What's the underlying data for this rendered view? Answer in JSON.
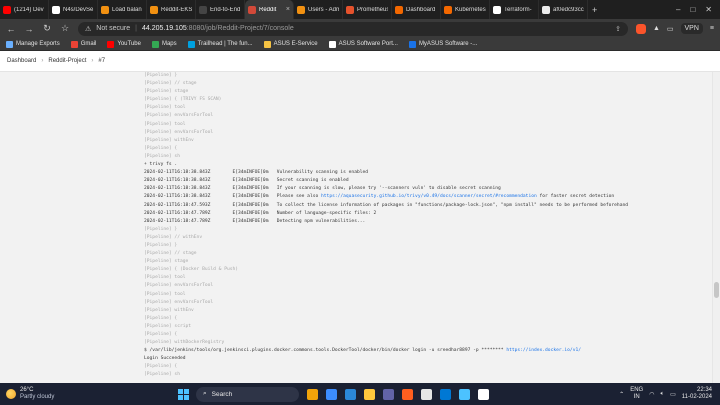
{
  "browser": {
    "tabs": [
      {
        "label": "(1214) Dev",
        "color": "#ff0000",
        "active": false
      },
      {
        "label": "N4s/DevSe",
        "color": "#ffffff",
        "active": false
      },
      {
        "label": "Load balan",
        "color": "#f29111",
        "active": false
      },
      {
        "label": "Reddit-EKS",
        "color": "#f29111",
        "active": false
      },
      {
        "label": "End-to-End",
        "color": "#444444",
        "active": false
      },
      {
        "label": "Reddit",
        "color": "#d24939",
        "active": true
      },
      {
        "label": "Users - Adm",
        "color": "#f29111",
        "active": false
      },
      {
        "label": "Prometheus",
        "color": "#e6522c",
        "active": false
      },
      {
        "label": "Dashboard",
        "color": "#f46800",
        "active": false
      },
      {
        "label": "Kubernetes",
        "color": "#f46800",
        "active": false
      },
      {
        "label": "Terraform-",
        "color": "#ffffff",
        "active": false
      },
      {
        "label": "af0edc93cc",
        "color": "#eaeaea",
        "active": false
      }
    ],
    "address": {
      "security": "Not secure",
      "host": "44.205.19.105",
      "path": ":8080/job/Reddit-Project/7/console"
    },
    "vpn_label": "VPN",
    "bookmarks": [
      {
        "label": "Manage Exports",
        "color": "#6ab0ff"
      },
      {
        "label": "Gmail",
        "color": "#ea4335"
      },
      {
        "label": "YouTube",
        "color": "#ff0000"
      },
      {
        "label": "Maps",
        "color": "#34a853"
      },
      {
        "label": "Trailhead | The fun...",
        "color": "#00a1e0"
      },
      {
        "label": "ASUS E-Service",
        "color": "#f6c343"
      },
      {
        "label": "ASUS Software Port...",
        "color": "#ffffff"
      },
      {
        "label": "MyASUS Software -...",
        "color": "#1a73e8"
      }
    ]
  },
  "jenkins": {
    "breadcrumb": [
      "Dashboard",
      "Reddit-Project",
      "#7"
    ]
  },
  "console_lines": [
    {
      "t": "[Pipeline] }",
      "k": "pl"
    },
    {
      "t": "[Pipeline] // stage",
      "k": "pl"
    },
    {
      "t": "[Pipeline] stage",
      "k": "pl"
    },
    {
      "t": "[Pipeline] { (TRIVY FS SCAN)",
      "k": "pl"
    },
    {
      "t": "[Pipeline] tool",
      "k": "pl"
    },
    {
      "t": "[Pipeline] envVarsForTool",
      "k": "pl"
    },
    {
      "t": "[Pipeline] tool",
      "k": "pl"
    },
    {
      "t": "[Pipeline] envVarsForTool",
      "k": "pl"
    },
    {
      "t": "[Pipeline] withEnv",
      "k": "pl"
    },
    {
      "t": "[Pipeline] {",
      "k": "pl"
    },
    {
      "t": "[Pipeline] sh",
      "k": "pl"
    },
    {
      "t": "+ trivy fs .",
      "k": ""
    },
    {
      "t": "2024-02-11T16:18:38.843Z        E[34mINFOE[0m   Vulnerability scanning is enabled",
      "k": ""
    },
    {
      "t": "2024-02-11T16:18:38.843Z        E[34mINFOE[0m   Secret scanning is enabled",
      "k": ""
    },
    {
      "t": "2024-02-11T16:18:38.843Z        E[34mINFOE[0m   If your scanning is slow, please try '--scanners vuln' to disable secret scanning",
      "k": ""
    },
    {
      "t": "2024-02-11T16:18:38.843Z        E[34mINFOE[0m   Please see also ",
      "k": "",
      "link": "https://aquasecurity.github.io/trivy/v0.49/docs/scanner/secret/#recommendation",
      "rest": " for faster secret detection"
    },
    {
      "t": "2024-02-11T16:18:47.593Z        E[34mINFOE[0m   To collect the license information of packages in \"functions/package-lock.json\", \"npm install\" needs to be performed beforehand",
      "k": ""
    },
    {
      "t": "2024-02-11T16:18:47.789Z        E[34mINFOE[0m   Number of language-specific files: 2",
      "k": ""
    },
    {
      "t": "2024-02-11T16:18:47.789Z        E[34mINFOE[0m   Detecting npm vulnerabilities...",
      "k": ""
    },
    {
      "t": "[Pipeline] }",
      "k": "pl"
    },
    {
      "t": "[Pipeline] // withEnv",
      "k": "pl"
    },
    {
      "t": "[Pipeline] }",
      "k": "pl"
    },
    {
      "t": "[Pipeline] // stage",
      "k": "pl"
    },
    {
      "t": "[Pipeline] stage",
      "k": "pl"
    },
    {
      "t": "[Pipeline] { (Docker Build & Push)",
      "k": "pl"
    },
    {
      "t": "[Pipeline] tool",
      "k": "pl"
    },
    {
      "t": "[Pipeline] envVarsForTool",
      "k": "pl"
    },
    {
      "t": "[Pipeline] tool",
      "k": "pl"
    },
    {
      "t": "[Pipeline] envVarsForTool",
      "k": "pl"
    },
    {
      "t": "[Pipeline] withEnv",
      "k": "pl"
    },
    {
      "t": "[Pipeline] {",
      "k": "pl"
    },
    {
      "t": "[Pipeline] script",
      "k": "pl"
    },
    {
      "t": "[Pipeline] {",
      "k": "pl"
    },
    {
      "t": "[Pipeline] withDockerRegistry",
      "k": "pl"
    },
    {
      "t": "$ /var/lib/jenkins/tools/org.jenkinsci.plugins.docker.commons.tools.DockerTool/docker/bin/docker login -u sreedhar8897 -p ******** ",
      "k": "",
      "link": "https://index.docker.io/v1/",
      "rest": ""
    },
    {
      "t": "Login Succeeded",
      "k": ""
    },
    {
      "t": "[Pipeline] {",
      "k": "pl"
    },
    {
      "t": "[Pipeline] sh",
      "k": "pl"
    }
  ],
  "taskbar": {
    "temp": "26°C",
    "condition": "Partly cloudy",
    "search": "Search",
    "lang1": "ENG",
    "lang2": "IN",
    "time": "22:34",
    "date": "11-02-2024",
    "apps": [
      "#f0a30a",
      "#3c8dff",
      "#2b88d8",
      "#ffc83d",
      "#6264a7",
      "#ff5f1f",
      "#e6e6e6",
      "#0078d4",
      "#4cc2ff",
      "#ffffff"
    ]
  }
}
